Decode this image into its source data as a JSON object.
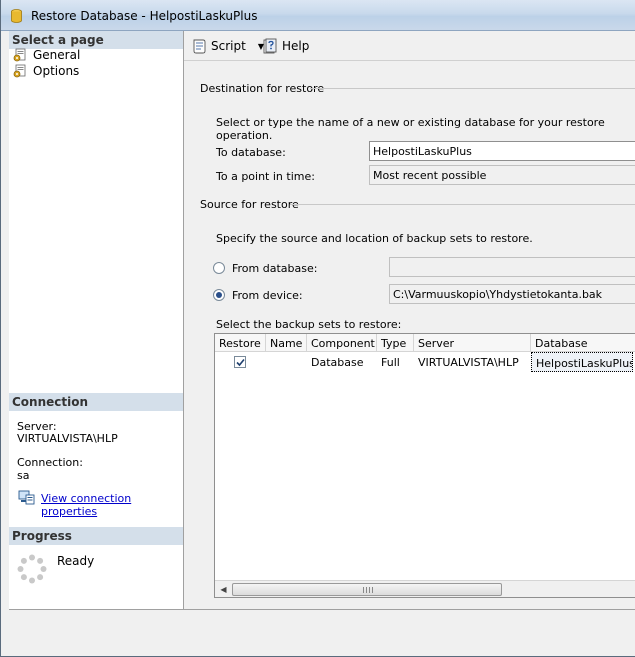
{
  "window": {
    "title": "Restore Database - HelpostiLaskuPlus"
  },
  "left_pane": {
    "select_page_header": "Select a page",
    "pages": [
      {
        "label": "General",
        "icon": "page-gear-icon"
      },
      {
        "label": "Options",
        "icon": "page-gear-icon"
      }
    ],
    "connection_header": "Connection",
    "server_label": "Server:",
    "server_value": "VIRTUALVISTA\\HLP",
    "connection_label": "Connection:",
    "connection_value": "sa",
    "view_connection_link": "View connection properties",
    "progress_header": "Progress",
    "progress_status": "Ready"
  },
  "toolbar": {
    "script_label": "Script",
    "help_label": "Help"
  },
  "destination": {
    "group_title": "Destination for restore",
    "instruction": "Select or type the name of a new or existing database for your restore operation.",
    "to_database_label": "To database:",
    "to_database_value": "HelpostiLaskuPlus",
    "point_in_time_label": "To a point in time:",
    "point_in_time_value": "Most recent possible"
  },
  "source": {
    "group_title": "Source for restore",
    "instruction": "Specify the source and location of backup sets to restore.",
    "from_database_label": "From database:",
    "from_database_value": "",
    "from_device_label": "From device:",
    "from_device_value": "C:\\Varmuuskopio\\Yhdystietokanta.bak",
    "selected_option": "from_device"
  },
  "backup_sets": {
    "label": "Select the backup sets to restore:",
    "columns": [
      "Restore",
      "Name",
      "Component",
      "Type",
      "Server",
      "Database"
    ],
    "rows": [
      {
        "restore": true,
        "name": "",
        "component": "Database",
        "type": "Full",
        "server": "VIRTUALVISTA\\HLP",
        "database": "HelpostiLaskuPlus"
      }
    ]
  }
}
